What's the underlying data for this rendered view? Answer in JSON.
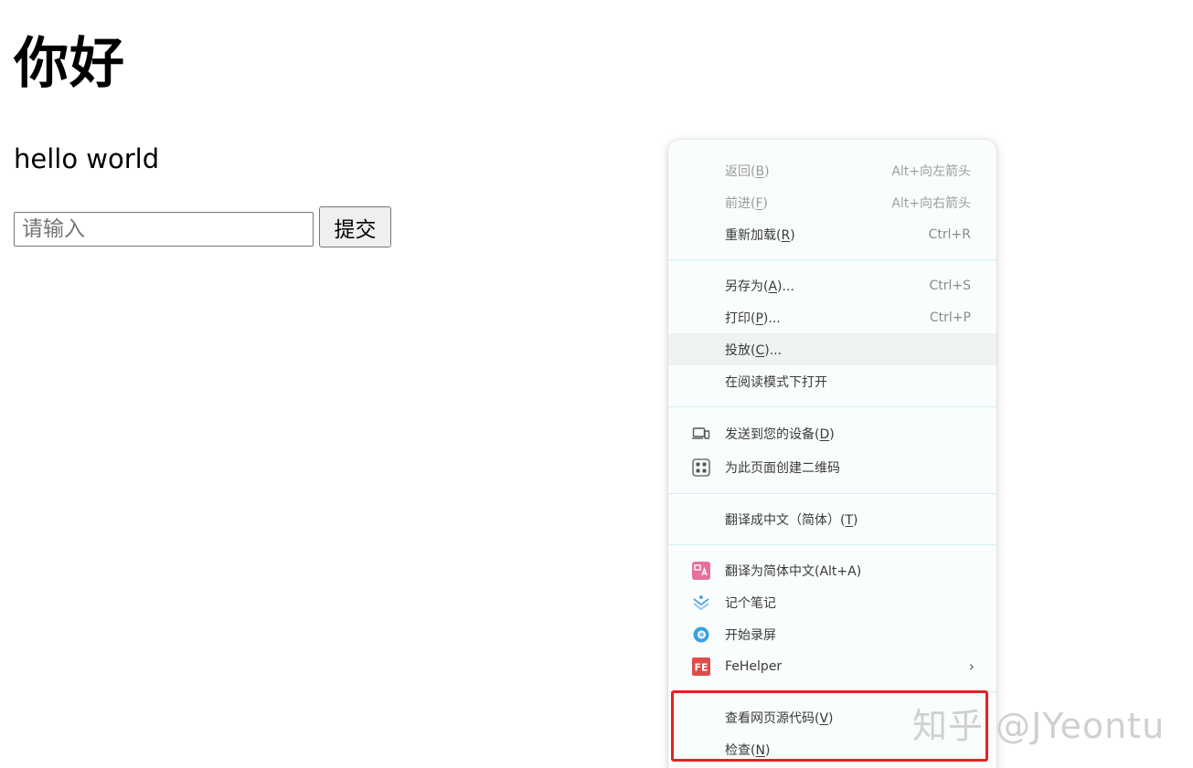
{
  "page": {
    "heading": "你好",
    "paragraph": "hello world",
    "input_placeholder": "请输入",
    "submit_label": "提交"
  },
  "context_menu": {
    "back": {
      "label": "返回(",
      "key": "B",
      "suffix": ")",
      "shortcut": "Alt+向左箭头"
    },
    "forward": {
      "label": "前进(",
      "key": "F",
      "suffix": ")",
      "shortcut": "Alt+向右箭头"
    },
    "reload": {
      "label": "重新加载(",
      "key": "R",
      "suffix": ")",
      "shortcut": "Ctrl+R"
    },
    "save_as": {
      "label": "另存为(",
      "key": "A",
      "suffix": ")...",
      "shortcut": "Ctrl+S"
    },
    "print": {
      "label": "打印(",
      "key": "P",
      "suffix": ")...",
      "shortcut": "Ctrl+P"
    },
    "cast": {
      "label": "投放(",
      "key": "C",
      "suffix": ")..."
    },
    "reader_mode": {
      "label": "在阅读模式下打开"
    },
    "send_to_device": {
      "label": "发送到您的设备(",
      "key": "D",
      "suffix": ")",
      "icon": "devices-icon"
    },
    "qr_code": {
      "label": "为此页面创建二维码",
      "icon": "qr-code-icon"
    },
    "translate": {
      "label": "翻译成中文（简体）(",
      "key": "T",
      "suffix": ")"
    },
    "translate_ext": {
      "label": "翻译为简体中文(Alt+A)",
      "icon": "translate-extension-icon",
      "color": "#e66f9c"
    },
    "notes": {
      "label": "记个笔记",
      "icon": "notes-icon",
      "color": "#5aa6e0"
    },
    "screen_record": {
      "label": "开始录屏",
      "icon": "screen-record-icon",
      "color": "#3aa0e0"
    },
    "fehelper": {
      "label": "FeHelper",
      "icon": "fehelper-icon",
      "color": "#e04b4b"
    },
    "view_source": {
      "label": "查看网页源代码(",
      "key": "V",
      "suffix": ")"
    },
    "inspect": {
      "label": "检查(",
      "key": "N",
      "suffix": ")"
    }
  },
  "watermark": "知乎 @JYeontu",
  "colors": {
    "highlight": "#e02424",
    "menu_bg": "#fafdfd",
    "separator": "#d3eef1"
  }
}
